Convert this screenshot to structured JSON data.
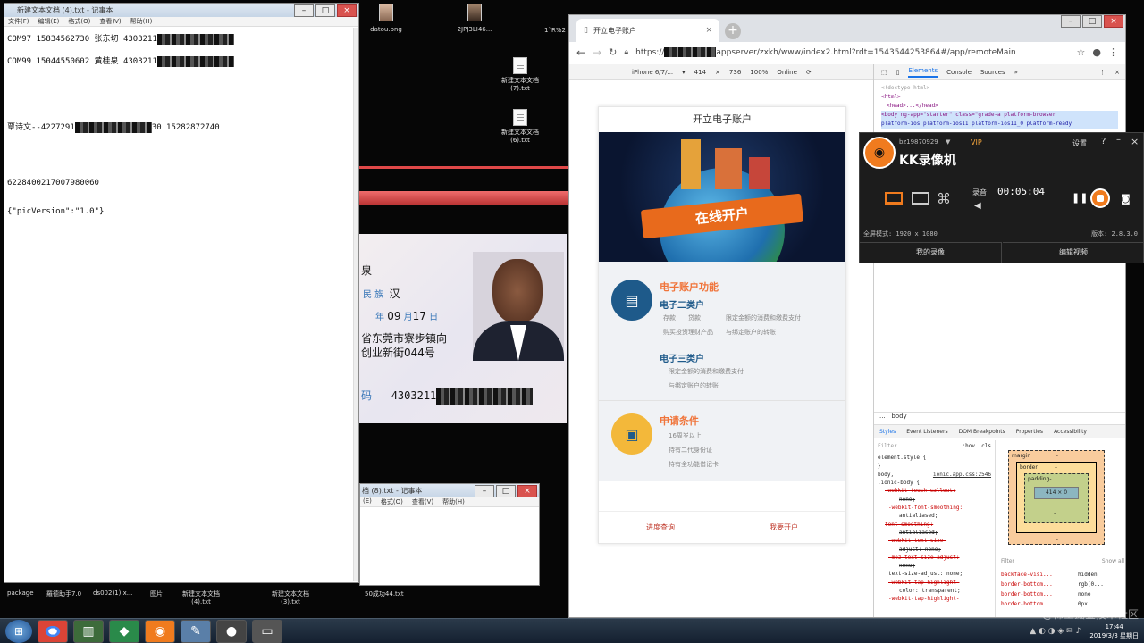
{
  "desktop": {
    "top_icons": [
      "datou.png",
      "2JPJ3LI46...",
      "1`R%2"
    ],
    "icon_mid1": "新建文本文档\n(7).txt",
    "icon_mid2": "新建文本文档\n(6).txt",
    "bottom": [
      "package",
      "羅德助手7.0",
      "ds002(1).x...",
      "图片",
      "新建文本文档\n(4).txt",
      "新建文本文档\n(3).txt",
      "50成功44.txt"
    ]
  },
  "notepad1": {
    "title": "新建文本文档 (4).txt - 记事本",
    "menu": [
      "文件(F)",
      "编辑(E)",
      "格式(O)",
      "查看(V)",
      "帮助(H)"
    ],
    "line1a": "COM97 15834562730 张东切 4303211",
    "line2a": "COM99 15044550602 黄桂泉 4303211",
    "line3a": "覃诗文--4227291",
    "line3b": "30 15282872740",
    "line4": "6228400217007980060",
    "line5": "{\"picVersion\":\"1.0\"}"
  },
  "notepad2": {
    "title": "档 (8).txt - 记事本",
    "menu": [
      "(E)",
      "格式(O)",
      "查看(V)",
      "帮助(H)"
    ]
  },
  "idcard": {
    "name_tail": "泉",
    "nation_label": "民 族",
    "nation": "汉",
    "birth_y": "年",
    "birth_m": "09",
    "birth_m_label": "月",
    "birth_d": "17",
    "birth_d_label": "日",
    "addr1": "省东莞市寮步镇向",
    "addr2": "创业新街044号",
    "num_label": "码",
    "num": "4303211"
  },
  "browser": {
    "tab": "开立电子账户",
    "url_prefix": "https://",
    "url": "appserver/zxkh/www/index2.html?rdt=1543544253864#/app/remoteMain",
    "device": "iPhone 6/7/...",
    "width": "414",
    "height": "736",
    "zoom": "100%",
    "network": "Online",
    "devtools_tabs": [
      "Elements",
      "Console",
      "Sources"
    ],
    "dom": [
      "<!doctype html>",
      "<html>",
      "<head>...</head>",
      "<body ng-app=\"starter\" class=\"grade-a platform-browser",
      "platform-ios platform-ios11 platform-ios11_0 platform-ready"
    ],
    "crumb": "body",
    "styles_tabs": [
      "Styles",
      "Event Listeners",
      "DOM Breakpoints",
      "Properties",
      "Accessibility"
    ],
    "filter": "Filter",
    "hov": ":hov .cls",
    "css_lines": [
      "element.style {",
      "}",
      "body,",
      "ionic.app.css:2546",
      ".ionic-body {",
      "-webkit-touch-callout:",
      "none;",
      "-webkit-font-smoothing:",
      "antialiased;",
      "font-smoothing:",
      "antialiased;",
      "-webkit-text-size-",
      "adjust: none;",
      "-moz-text-size-adjust:",
      "none;",
      "text-size-adjust: none;",
      "-webkit-tap-highlight-",
      "color: transparent;",
      "-webkit-tap-highlight-"
    ],
    "box": {
      "margin": "margin",
      "border": "border",
      "padding": "padding-",
      "content": "414 × 0",
      "dash": "–"
    },
    "computed_filter": "Filter",
    "show_all": "Show all",
    "computed": [
      [
        "backface-visi...",
        "hidden"
      ],
      [
        "border-bottom...",
        "rgb(0..."
      ],
      [
        "border-bottom...",
        "none"
      ],
      [
        "border-bottom...",
        "0px"
      ]
    ]
  },
  "mobile": {
    "header": "开立电子账户",
    "banner": "在线开户",
    "sec1_title": "电子账户功能",
    "class2": "电子二类户",
    "class2_items": [
      "存款",
      "贷款",
      "限定金额的消费和缴费支付",
      "购买投资理财产品",
      "与绑定账户的转账"
    ],
    "class3": "电子三类户",
    "class3_items": [
      "限定金额的消费和缴费支付",
      "与绑定账户的转账"
    ],
    "sec2_title": "申请条件",
    "cond_items": [
      "16周岁以上",
      "持有二代身份证",
      "持有全功能借记卡"
    ],
    "footer_left": "进度查询",
    "footer_right": "我要开户"
  },
  "kk": {
    "user": "bz19870929",
    "vip": "VIP",
    "settings": "设置",
    "help": "?",
    "title": "KK录像机",
    "rec_label": "录音",
    "time": "00:05:04",
    "mode": "全屏模式: 1920 x 1080",
    "version": "版本: 2.8.3.0",
    "btn_left": "我的录像",
    "btn_right": "编辑视频"
  },
  "taskbar": {
    "time": "17:44",
    "date": "2019/3/3 星期日",
    "watermark": "@稀土掘金技术社区"
  },
  "colors": {
    "accent": "#f0743a",
    "blue": "#1e5a8a",
    "kk_orange": "#f07b1e"
  }
}
